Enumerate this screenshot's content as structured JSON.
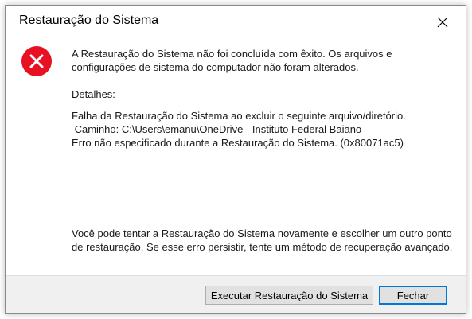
{
  "dialog": {
    "title": "Restauração do Sistema",
    "close_icon": "close-icon",
    "error_icon": "error-icon",
    "main_message": "A Restauração do Sistema não foi concluída com êxito. Os arquivos e configurações de sistema do computador não foram alterados.",
    "details_label": "Detalhes:",
    "details_lines": [
      "Falha da Restauração do Sistema ao excluir o seguinte arquivo/diretório.",
      " Caminho: C:\\Users\\emanu\\OneDrive - Instituto Federal Baiano",
      "Erro não especificado durante a Restauração do Sistema. (0x80071ac5)"
    ],
    "bottom_message": "Você pode tentar a Restauração do Sistema novamente e escolher um outro ponto de restauração. Se esse erro persistir, tente um método de recuperação avançado.",
    "buttons": {
      "run_restore": "Executar Restauração do Sistema",
      "close": "Fechar"
    }
  },
  "colors": {
    "error_red": "#e81123",
    "focus_blue": "#0078d7",
    "footer_bg": "#f0f0f0"
  }
}
